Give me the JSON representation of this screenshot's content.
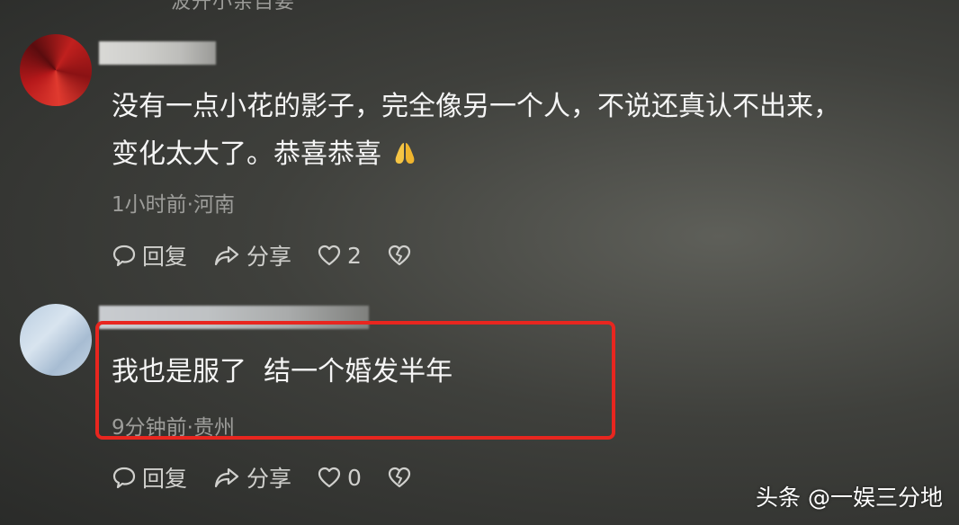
{
  "top_cut_text": "波开小亲自要",
  "comments": [
    {
      "text_line1": "没有一点小花的影子，完全像另一个人，不说还真认不出来，",
      "text_line2": "变化太大了。恭喜恭喜",
      "meta": "1小时前·河南",
      "reply_label": "回复",
      "share_label": "分享",
      "like_count": "2"
    },
    {
      "text_line1": "我也是服了  结一个婚发半年",
      "meta": "9分钟前·贵州",
      "reply_label": "回复",
      "share_label": "分享",
      "like_count": "0"
    }
  ],
  "watermark": "头条 @一娱三分地",
  "colors": {
    "highlight_border": "#e8261f",
    "meta_text": "#9d9d9a"
  },
  "icons": [
    "comment-icon",
    "share-icon",
    "heart-icon",
    "broken-heart-icon",
    "pray-hands-emoji"
  ]
}
